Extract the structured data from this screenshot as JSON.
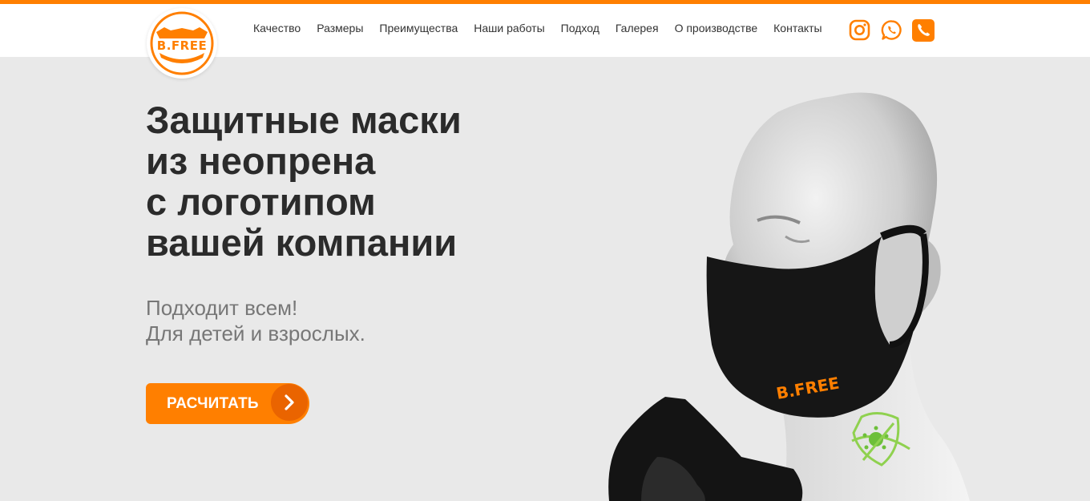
{
  "brand": {
    "logo_text": "B.FREE",
    "accent_color": "#ff7f00"
  },
  "nav": {
    "items": [
      {
        "label": "Качество"
      },
      {
        "label": "Размеры"
      },
      {
        "label": "Преимущества"
      },
      {
        "label": "Наши работы"
      },
      {
        "label": "Подход"
      },
      {
        "label": "Галерея"
      },
      {
        "label": "О производстве"
      },
      {
        "label": "Контакты"
      }
    ]
  },
  "social": {
    "icons": [
      "instagram-icon",
      "whatsapp-icon",
      "phone-icon"
    ]
  },
  "hero": {
    "title_lines": [
      "Защитные маски",
      "из неопрена",
      "с логотипом",
      "вашей компании"
    ],
    "subtitle_lines": [
      "Подходит всем!",
      "Для детей и взрослых."
    ],
    "cta_label": "РАСЧИТАТЬ",
    "mask_print": "B.FREE"
  }
}
